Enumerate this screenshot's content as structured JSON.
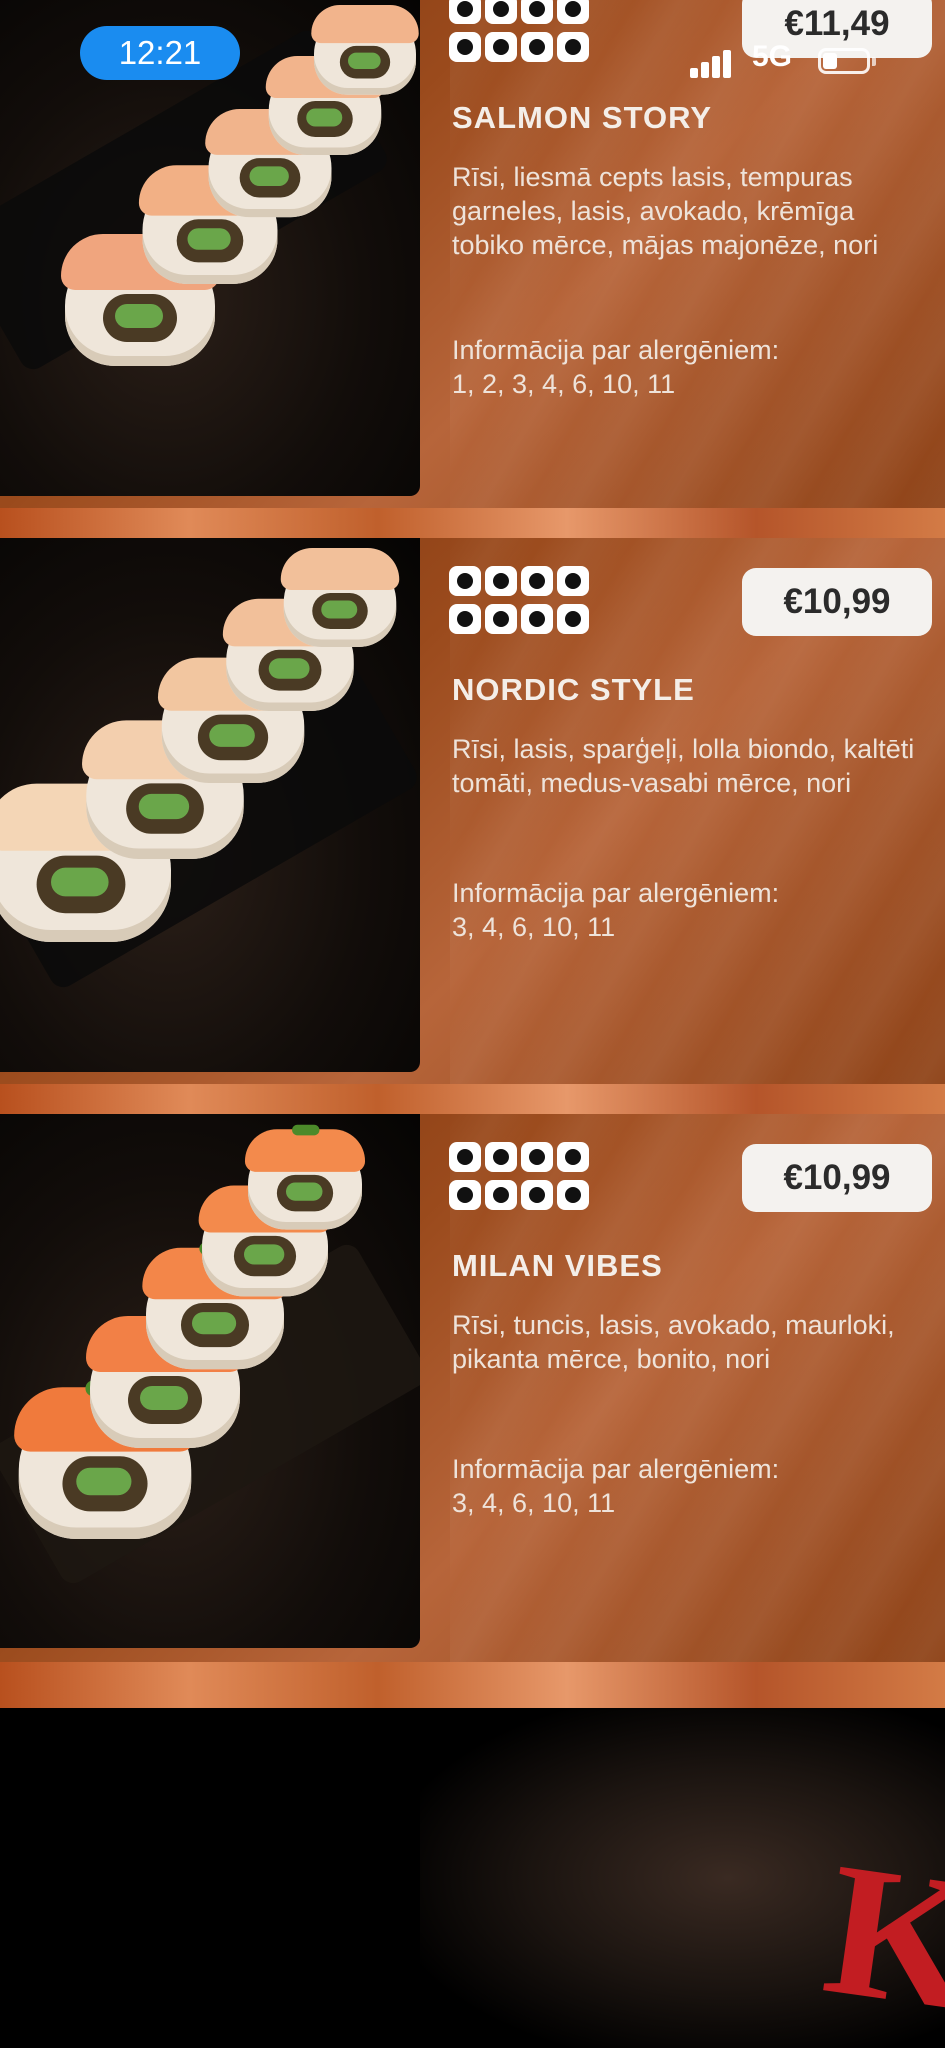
{
  "status_bar": {
    "time": "12:21",
    "network": "5G"
  },
  "menu": {
    "items": [
      {
        "name": "SALMON STORY",
        "price": "€11,49",
        "description": "Rīsi, liesmā cepts lasis, tempuras garneles, lasis, avokado, krēmīga tobiko mērce, mājas majonēze, nori",
        "allergen_label": "Informācija par alergēniem:",
        "allergens": "1, 2, 3, 4, 6, 10, 11"
      },
      {
        "name": "NORDIC STYLE",
        "price": "€10,99",
        "description": "Rīsi, lasis, sparģeļi, lolla biondo, kaltēti tomāti, medus-vasabi mērce, nori",
        "allergen_label": "Informācija par alergēniem:",
        "allergens": "3, 4, 6, 10, 11"
      },
      {
        "name": "MILAN VIBES",
        "price": "€10,99",
        "description": "Rīsi, tuncis, lasis, avokado, maurloki, pikanta mērce, bonito, nori",
        "allergen_label": "Informācija par alergēniem:",
        "allergens": "3, 4, 6, 10, 11"
      }
    ]
  },
  "colors": {
    "accent": "#1a8cf0",
    "card": "#9a4a1c",
    "brand_red": "#c21d22"
  }
}
